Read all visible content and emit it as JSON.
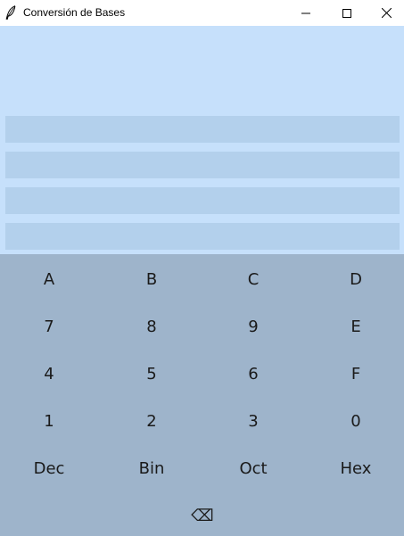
{
  "window": {
    "title": "Conversión de Bases",
    "icon": "feather-icon",
    "controls": [
      "minimize-icon",
      "maximize-icon",
      "close-icon"
    ]
  },
  "display": {
    "fields": [
      {
        "value": ""
      },
      {
        "value": ""
      },
      {
        "value": ""
      },
      {
        "value": ""
      }
    ]
  },
  "keypad": {
    "row1": [
      "A",
      "B",
      "C",
      "D"
    ],
    "row2": [
      "7",
      "8",
      "9",
      "E"
    ],
    "row3": [
      "4",
      "5",
      "6",
      "F"
    ],
    "row4": [
      "1",
      "2",
      "3",
      "0"
    ],
    "row5": [
      "Dec",
      "Bin",
      "Oct",
      "Hex"
    ],
    "backspace": "⌫"
  },
  "colors": {
    "display_bg": "#c6e0fb",
    "field_bg": "#b3d0ec",
    "keypad_bg": "#9eb4cb",
    "text": "#1a1a1a"
  }
}
